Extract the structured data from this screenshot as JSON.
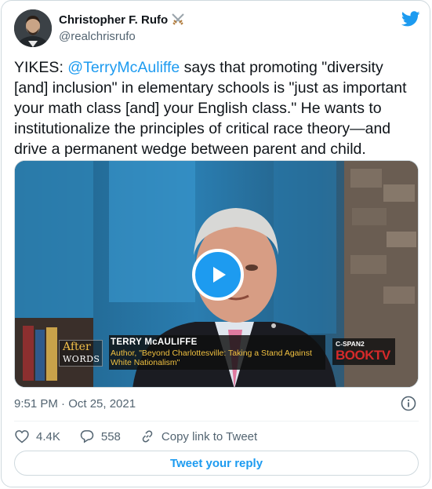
{
  "author": {
    "display_name": "Christopher F. Rufo",
    "handle": "@realchrisrufo",
    "badge_icon": "crossed-swords-icon"
  },
  "brand_icon": "twitter-bird-icon",
  "tweet": {
    "prefix": "YIKES: ",
    "mention": "@TerryMcAuliffe",
    "body": " says that promoting \"diversity [and] inclusion\" in elementary schools is \"just as important your math class [and] your English class.\" He wants to institutionalize the principles of critical race theory—and drive a permanent wedge between parent and child."
  },
  "media": {
    "chyron_name": "TERRY McAULIFFE",
    "chyron_subtitle": "Author, \"Beyond Charlottesville: Taking a Stand Against White Nationalism\"",
    "show_logo_top": "After",
    "show_logo_bottom": "WORDS",
    "network_top": "C-SPAN2",
    "network_book": "BOOK",
    "network_tv": "TV",
    "play_icon": "play-icon"
  },
  "meta": {
    "timestamp": "9:51 PM · Oct 25, 2021",
    "info_icon": "info-icon"
  },
  "actions": {
    "likes": "4.4K",
    "replies": "558",
    "copy_link": "Copy link to Tweet"
  },
  "reply_button": "Tweet your reply",
  "colors": {
    "accent": "#1d9bf0",
    "text": "#0f1419",
    "secondary": "#536471",
    "border": "#cfd9de"
  }
}
